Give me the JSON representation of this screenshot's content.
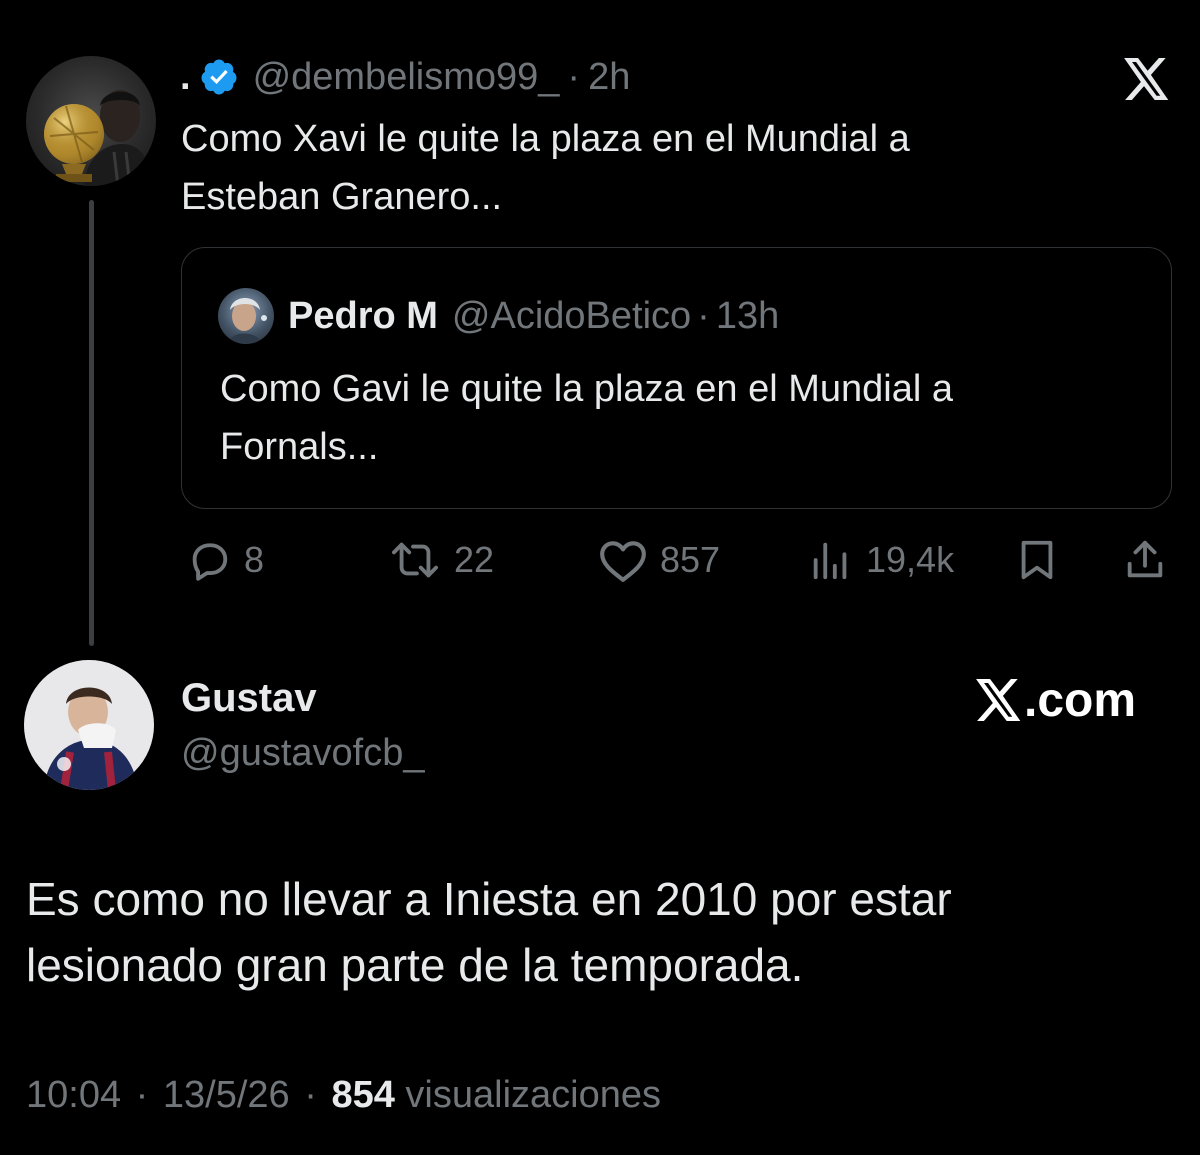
{
  "colors": {
    "background": "#000000",
    "text_primary": "#e7e9ea",
    "text_secondary": "#71767b",
    "border": "#2f3336",
    "verified_badge": "#1d9bf0"
  },
  "tweet": {
    "display_name": ".",
    "handle": "@dembelismo99_",
    "separator": "·",
    "time": "2h",
    "text": "Como Xavi le quite la plaza en el Mundial a\nEsteban Granero...",
    "verified": true,
    "avatar_icon": "profile-photo-ballon-dor",
    "platform_icon": "x-logo-icon"
  },
  "quoted_tweet": {
    "display_name": "Pedro M",
    "handle": "@AcidoBetico",
    "separator": "·",
    "time": "13h",
    "text": "Como Gavi le quite la plaza en el Mundial a\nFornals...",
    "avatar_icon": "profile-photo"
  },
  "actions": {
    "replies": "8",
    "retweets": "22",
    "likes": "857",
    "views": "19,4k",
    "icons": [
      "reply-icon",
      "retweet-icon",
      "like-icon",
      "views-icon",
      "bookmark-icon",
      "share-icon"
    ]
  },
  "reply": {
    "display_name": "Gustav",
    "handle": "@gustavofcb_",
    "watermark": ".com",
    "text": "Es como no llevar a Iniesta en 2010 por estar\nlesionado gran parte de la temporada.",
    "time": "10:04",
    "separator": "·",
    "date": "13/5/26",
    "views_count": "854",
    "views_label": "visualizaciones"
  }
}
